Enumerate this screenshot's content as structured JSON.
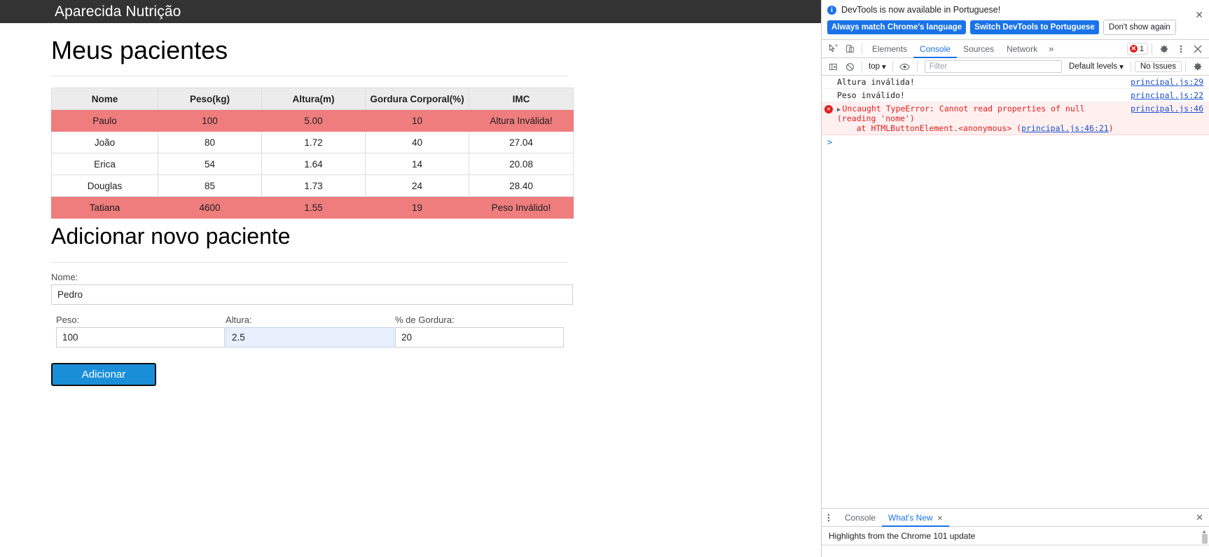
{
  "app": {
    "navbar_title": "Aparecida Nutrição",
    "page_title": "Meus pacientes",
    "section_title": "Adicionar novo paciente",
    "accent_color": "#1a8fd8",
    "navbar_color": "#333333",
    "invalid_row_color": "#ef7d7d",
    "header_row_color": "#ececec"
  },
  "table": {
    "columns": [
      "Nome",
      "Peso(kg)",
      "Altura(m)",
      "Gordura Corporal(%)",
      "IMC"
    ],
    "rows": [
      {
        "nome": "Paulo",
        "peso": "100",
        "altura": "5.00",
        "gordura": "10",
        "imc": "Altura Inválida!",
        "invalid": true
      },
      {
        "nome": "João",
        "peso": "80",
        "altura": "1.72",
        "gordura": "40",
        "imc": "27.04",
        "invalid": false
      },
      {
        "nome": "Erica",
        "peso": "54",
        "altura": "1.64",
        "gordura": "14",
        "imc": "20.08",
        "invalid": false
      },
      {
        "nome": "Douglas",
        "peso": "85",
        "altura": "1.73",
        "gordura": "24",
        "imc": "28.40",
        "invalid": false
      },
      {
        "nome": "Tatiana",
        "peso": "4600",
        "altura": "1.55",
        "gordura": "19",
        "imc": "Peso Inválido!",
        "invalid": true
      }
    ]
  },
  "form": {
    "nome_label": "Nome:",
    "nome_value": "Pedro",
    "peso_label": "Peso:",
    "peso_value": "100",
    "altura_label": "Altura:",
    "altura_value": "2.5",
    "gordura_label": "% de Gordura:",
    "gordura_value": "20",
    "submit_label": "Adicionar"
  },
  "devtools": {
    "banner": {
      "message": "DevTools is now available in Portuguese!",
      "primary_button": "Always match Chrome's language",
      "secondary_button": "Switch DevTools to Portuguese",
      "tertiary_button": "Don't show again",
      "close": "✕"
    },
    "tabs": [
      {
        "label": "Elements",
        "active": false
      },
      {
        "label": "Console",
        "active": true
      },
      {
        "label": "Sources",
        "active": false
      },
      {
        "label": "Network",
        "active": false
      }
    ],
    "more_tabs": "»",
    "error_count": "1",
    "toolbar": {
      "context": "top",
      "filter_placeholder": "Filter",
      "levels": "Default levels",
      "issues": "No Issues"
    },
    "messages": [
      {
        "text": "Altura inválida!",
        "source": "principal.js:29",
        "level": "log"
      },
      {
        "text": "Peso inválido!",
        "source": "principal.js:22",
        "level": "log"
      },
      {
        "text": "Uncaught TypeError: Cannot read properties of null (reading 'nome')",
        "stack_prefix": "    at HTMLButtonElement.<anonymous> (",
        "stack_link": "principal.js:46:21",
        "stack_suffix": ")",
        "source": "principal.js:46",
        "level": "error"
      }
    ],
    "prompt": ">",
    "drawer": {
      "tabs": [
        {
          "label": "Console",
          "active": false,
          "closable": false
        },
        {
          "label": "What's New",
          "active": true,
          "closable": true
        }
      ],
      "content": "Highlights from the Chrome 101 update",
      "close": "✕"
    }
  }
}
